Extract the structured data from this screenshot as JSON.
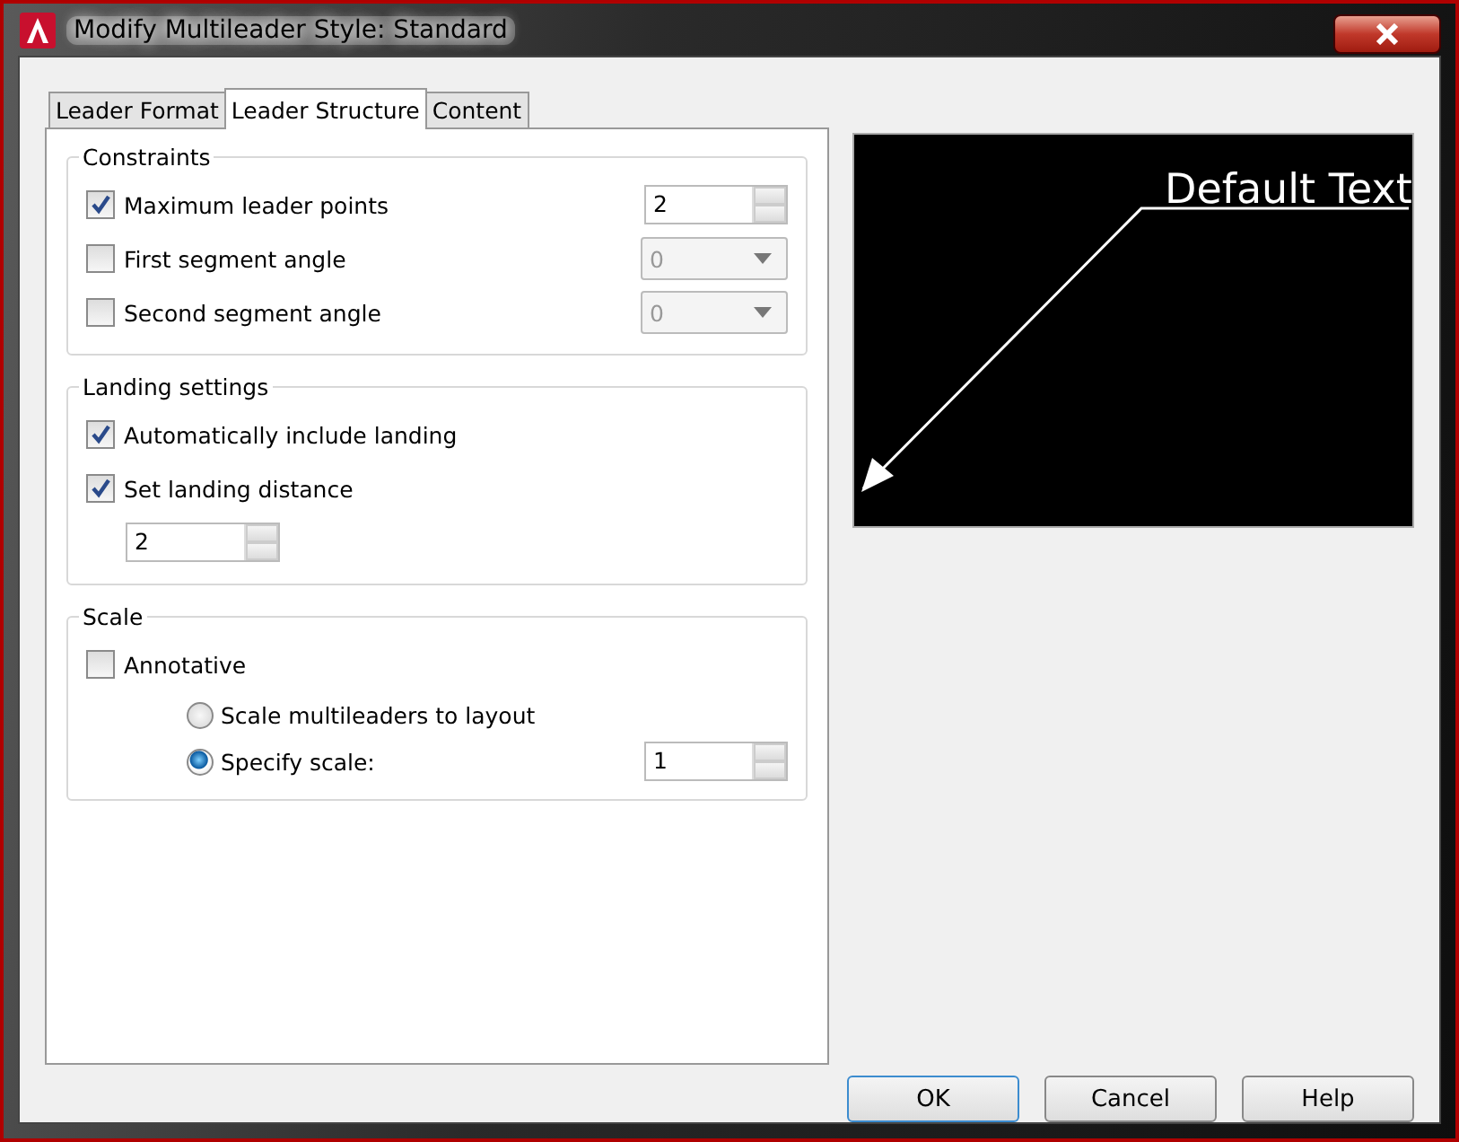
{
  "window": {
    "title": "Modify Multileader Style: Standard"
  },
  "tabs": [
    {
      "label": "Leader Format",
      "selected": false
    },
    {
      "label": "Leader Structure",
      "selected": true
    },
    {
      "label": "Content",
      "selected": false
    }
  ],
  "groups": [
    {
      "title": "Constraints",
      "rows": [
        {
          "kind": "checkbox",
          "label": "Maximum leader points",
          "checked": true,
          "control": {
            "kind": "spinner",
            "value": "2",
            "disabled": false
          }
        },
        {
          "kind": "checkbox",
          "label": "First segment angle",
          "checked": false,
          "control": {
            "kind": "dropdown",
            "value": "0",
            "disabled": true
          }
        },
        {
          "kind": "checkbox",
          "label": "Second segment angle",
          "checked": false,
          "control": {
            "kind": "dropdown",
            "value": "0",
            "disabled": true
          }
        }
      ]
    },
    {
      "title": "Landing settings",
      "rows": [
        {
          "kind": "checkbox",
          "label": "Automatically include landing",
          "checked": true
        },
        {
          "kind": "checkbox",
          "label": "Set landing distance",
          "checked": true
        },
        {
          "kind": "spinner",
          "value": "2"
        }
      ]
    },
    {
      "title": "Scale",
      "rows": [
        {
          "kind": "checkbox",
          "label": "Annotative",
          "checked": false
        },
        {
          "kind": "radio",
          "label": "Scale multileaders to layout",
          "selected": false
        },
        {
          "kind": "radio",
          "label": "Specify scale:",
          "selected": true,
          "control": {
            "kind": "spinner",
            "value": "1",
            "disabled": false
          }
        }
      ]
    }
  ],
  "preview": {
    "text": "Default Text"
  },
  "buttons": [
    {
      "label": "OK",
      "default": true
    },
    {
      "label": "Cancel",
      "default": false
    },
    {
      "label": "Help",
      "default": false
    }
  ]
}
